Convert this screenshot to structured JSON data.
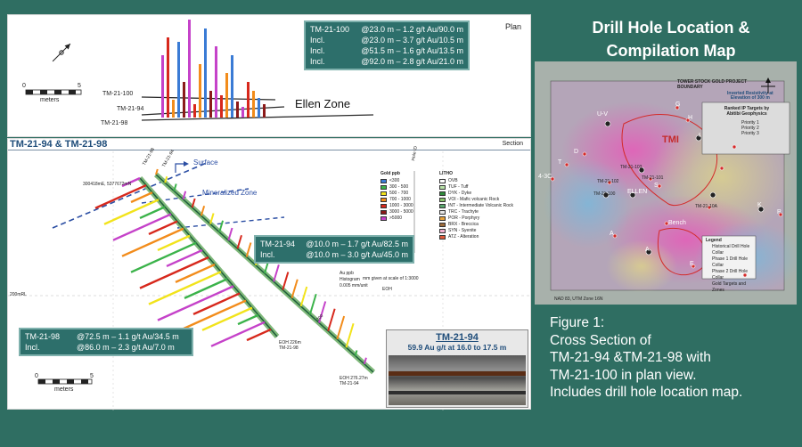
{
  "title": {
    "line1": "Drill Hole Location &",
    "line2": "Compilation Map"
  },
  "plan": {
    "corner": "Plan",
    "scale": {
      "left": "0",
      "right": "5",
      "unit": "meters"
    },
    "holes": [
      "TM-21-100",
      "TM-21-94",
      "TM-21-98"
    ],
    "zone_label": "Ellen Zone",
    "callout": [
      {
        "k": "TM-21-100",
        "v": "@23.0 m – 1.2 g/t Au/90.0 m"
      },
      {
        "k": "Incl.",
        "v": "@23.0 m – 3.7 g/t Au/10.5 m"
      },
      {
        "k": "Incl.",
        "v": "@51.5 m – 1.6 g/t Au/13.5 m"
      },
      {
        "k": "Incl.",
        "v": "@92.0 m – 2.8 g/t Au/21.0 m"
      }
    ]
  },
  "section": {
    "title": "TM-21-94 & TM-21-98",
    "corner": "Section",
    "surface": "Surface",
    "mineralized": "Mineralized Zone",
    "coords": "300418mE, 5377672mN",
    "hole_top1": "TM-21-98",
    "hole_top2": "TM-21-94",
    "hole_id": "Hole ID",
    "elev": "200mRL",
    "histogram": {
      "l1": "Au ppb",
      "l2": "Histogram",
      "l3": "0.005 mm/unit"
    },
    "scale_note": "mm given at scale of 1:3000",
    "eoh": "EOH",
    "eoh98": {
      "l1": "EOH 226m",
      "l2": "TM-21-98"
    },
    "eoh94": {
      "l1": "EOH 276.27m",
      "l2": "TM-21-94"
    },
    "depth200": "200",
    "scale": {
      "left": "0",
      "right": "5",
      "unit": "meters"
    },
    "callout94": [
      {
        "k": "TM-21-94",
        "v": "@10.0 m – 1.7 g/t Au/82.5 m"
      },
      {
        "k": "Incl.",
        "v": "@10.0 m – 3.0 g/t Au/45.0 m"
      }
    ],
    "callout98": [
      {
        "k": "TM-21-98",
        "v": "@72.5 m – 1.1 g/t Au/34.5 m"
      },
      {
        "k": "Incl.",
        "v": "@86.0 m – 2.3 g/t Au/7.0 m"
      }
    ],
    "gold_legend": {
      "title": "Gold ppb",
      "items": [
        {
          "label": "<300",
          "color": "#3a7bd5"
        },
        {
          "label": "300 - 500",
          "color": "#3bb34a"
        },
        {
          "label": "500 - 700",
          "color": "#f2e31b"
        },
        {
          "label": "700 - 1000",
          "color": "#f28c1b"
        },
        {
          "label": "1000 - 3000",
          "color": "#d7281c"
        },
        {
          "label": "3000 - 5000",
          "color": "#8b1a1a"
        },
        {
          "label": ">5000",
          "color": "#c542c9"
        }
      ]
    },
    "litho_legend": {
      "title": "LITHO",
      "items": [
        {
          "label": "OVB",
          "color": "#ffffff"
        },
        {
          "label": "TUF - Tuff",
          "color": "#b9e3a8"
        },
        {
          "label": "DYK - Dyke",
          "color": "#2e8b3a"
        },
        {
          "label": "VOI - Mafic volcanic Rock",
          "color": "#88c46b"
        },
        {
          "label": "INT - Intermediate Volcanic Rock",
          "color": "#5aa86e"
        },
        {
          "label": "TRC - Trachyte",
          "color": "#e5e5e5"
        },
        {
          "label": "POR - Porphyry",
          "color": "#e7a23b"
        },
        {
          "label": "BRX - Breccica",
          "color": "#9d6b3a"
        },
        {
          "label": "SYN - Syenite",
          "color": "#f3b2d0"
        },
        {
          "label": "ATZ - Alteration",
          "color": "#e05a3a"
        }
      ]
    },
    "core": {
      "title": "TM-21-94",
      "subtitle": "59.9 Au g/t at 16.0 to 17.5 m"
    }
  },
  "map": {
    "header_line1": "TOWER STOCK GOLD PROJECT",
    "header_line2": "BOUNDARY",
    "inverted_line1": "Inverted Resistivity at",
    "inverted_line2": "Elevation of 300 m",
    "ranked_line1": "Ranked IP Targets by",
    "ranked_line2": "Abitibi Geophysics",
    "priorities": [
      "Priority 1",
      "Priority 2",
      "Priority 3"
    ],
    "tmi": "TMI",
    "letters": [
      "U-V",
      "G",
      "H",
      "I",
      "T",
      "4-3C",
      "ELLEN",
      "S",
      "Bench",
      "A",
      "A",
      "E",
      "F",
      "K",
      "P",
      "D"
    ],
    "holes": [
      "TM-21-103",
      "TM-21-101",
      "TM-21-102",
      "TM-21-100",
      "TM-21-10A"
    ],
    "legend_title": "Legend",
    "legend_items": [
      "Historical Drill Hole Collar",
      "Phase 1 Drill Hole Collar",
      "Phase 2 Drill Hole Collar",
      "Gold Targets and Zones"
    ],
    "footer": "NAD 83, UTM Zone 16N"
  },
  "figure": {
    "l1": "Figure 1:",
    "l2": "Cross Section of",
    "l3": "TM-21-94 &TM-21-98 with",
    "l4": "TM-21-100 in plan view.",
    "l5": "Includes drill hole location map."
  },
  "colors": {
    "background": "#2f6e62",
    "callout": "#2d6f6b",
    "section_title": "#1f4d7a",
    "accent": "#c52a2a"
  }
}
